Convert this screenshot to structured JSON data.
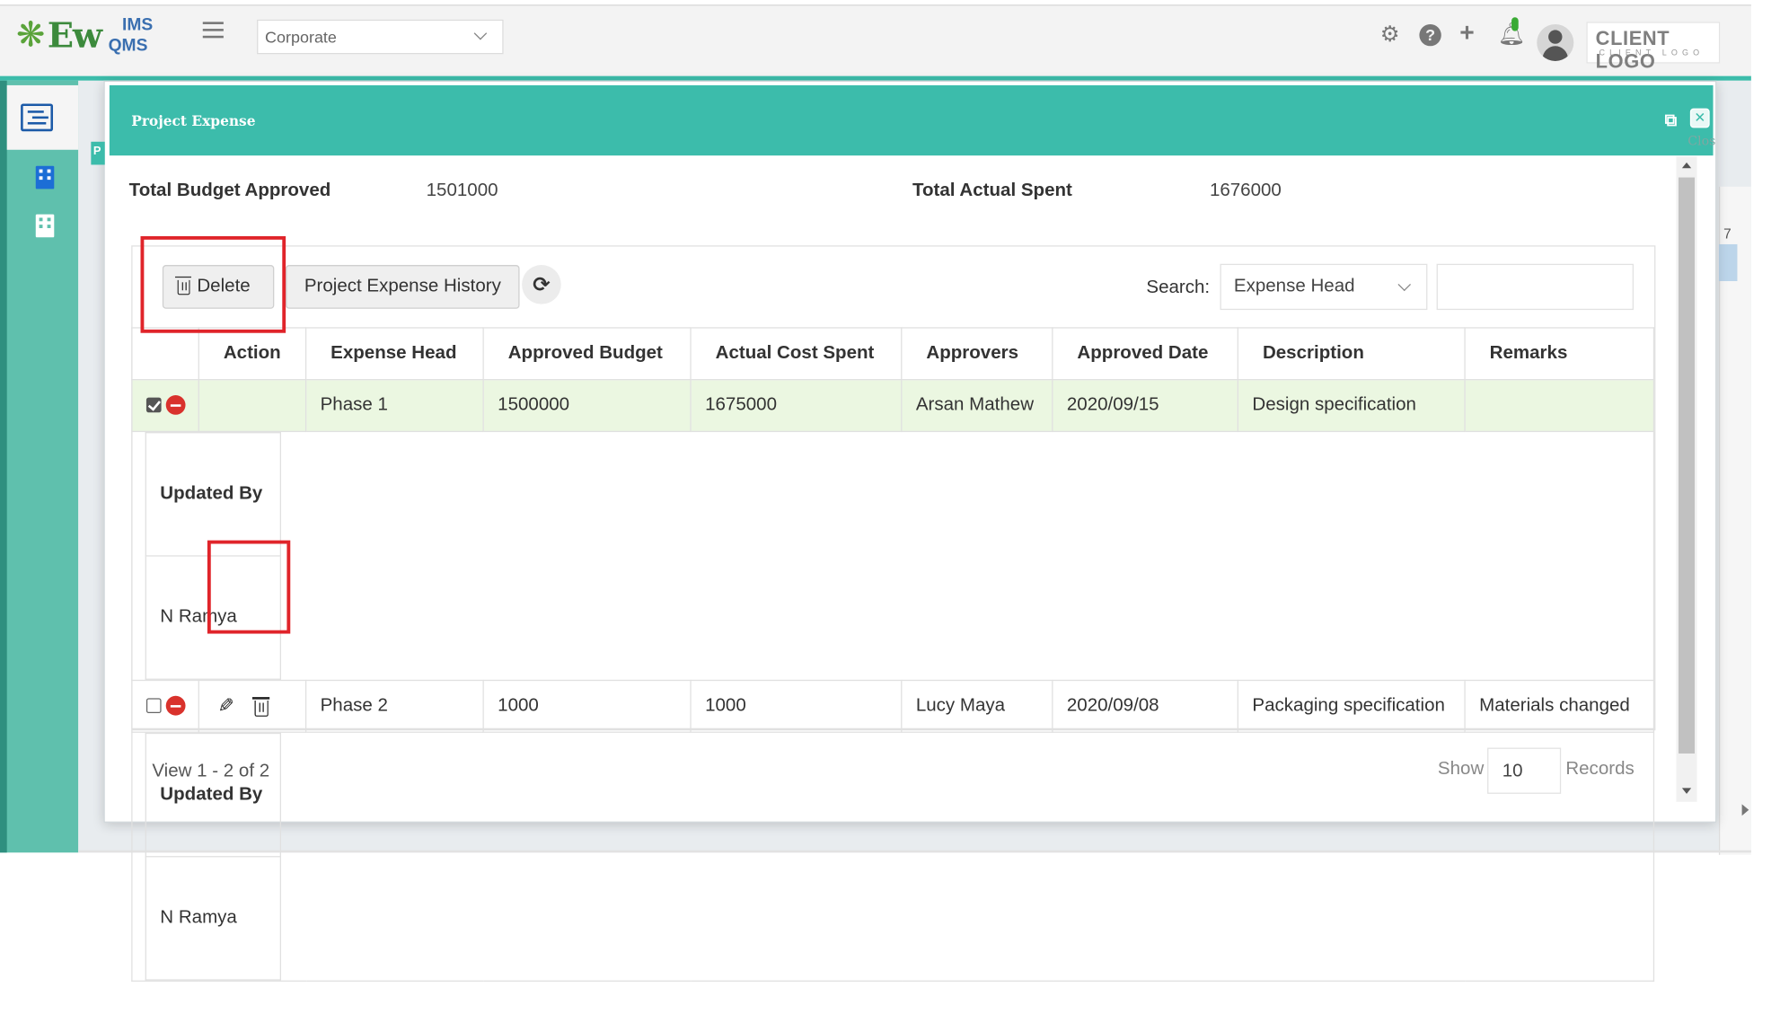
{
  "header": {
    "logo_text": "Ew",
    "logo_sub_top": "IMS",
    "logo_sub_bottom": "QMS",
    "site_select": "Corporate",
    "client_logo": "CLIENT LOGO",
    "client_logo_sub": "CLIENT LOGO"
  },
  "modal": {
    "title": "Project Expense",
    "close_label": "Clos",
    "left_tab": "P"
  },
  "summary": {
    "budget_label": "Total Budget Approved",
    "budget_value": "1501000",
    "spent_label": "Total Actual Spent",
    "spent_value": "1676000"
  },
  "toolbar": {
    "delete_label": "Delete",
    "history_label": "Project Expense History",
    "search_label": "Search:",
    "search_field": "Expense Head",
    "search_value": ""
  },
  "table": {
    "columns": [
      "Action",
      "Expense Head",
      "Approved Budget",
      "Actual Cost Spent",
      "Approvers",
      "Approved Date",
      "Description",
      "Remarks"
    ],
    "rows": [
      {
        "checked": true,
        "expense_head": "Phase 1",
        "approved_budget": "1500000",
        "actual_cost": "1675000",
        "approvers": "Arsan Mathew",
        "approved_date": "2020/09/15",
        "description": "Design specification",
        "remarks": "",
        "sub_header": "Updated By",
        "sub_value": "N Ramya"
      },
      {
        "checked": false,
        "expense_head": "Phase 2",
        "approved_budget": "1000",
        "actual_cost": "1000",
        "approvers": "Lucy Maya",
        "approved_date": "2020/09/08",
        "description": "Packaging specification",
        "remarks": "Materials changed",
        "sub_header": "Updated By",
        "sub_value": "N Ramya"
      }
    ]
  },
  "pager": {
    "view_text": "View 1 - 2 of 2",
    "show_label": "Show",
    "page_size": "10",
    "records_label": "Records"
  },
  "background": {
    "side_number": "7"
  },
  "colors": {
    "accent": "#3cbcab",
    "highlight_box": "#e0242a",
    "selected_row": "#ebf7e1",
    "remove_icon": "#d9322c"
  }
}
